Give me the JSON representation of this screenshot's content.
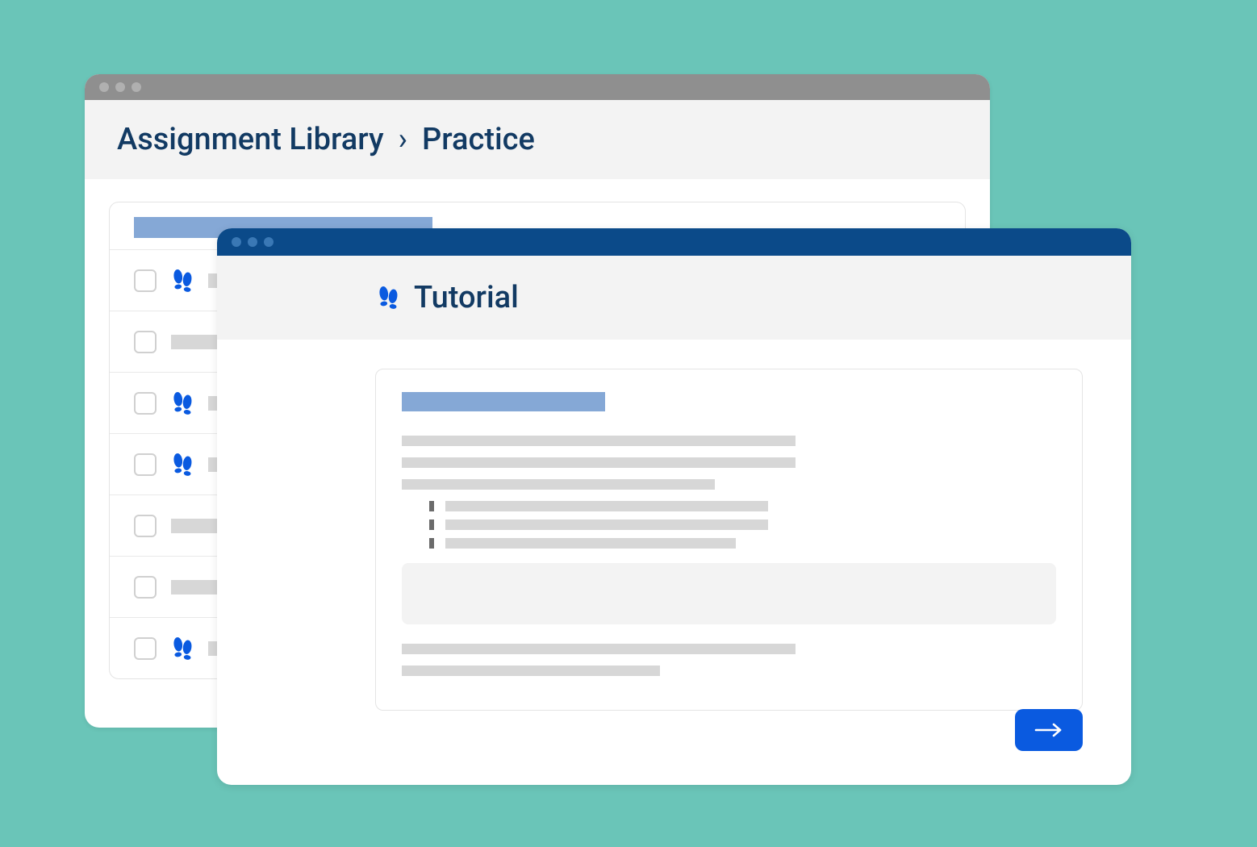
{
  "colors": {
    "background": "#6ac5b8",
    "back_titlebar": "#8f8f8f",
    "front_titlebar": "#0b4a89",
    "accent": "#0a5ae0",
    "heading_text": "#123a63",
    "placeholder_light_blue": "#85a8d6",
    "placeholder_gray": "#d7d7d7",
    "panel_gray": "#f3f3f3"
  },
  "back_window": {
    "breadcrumb": {
      "root": "Assignment Library",
      "separator": "›",
      "current": "Practice"
    },
    "list_items": [
      {
        "has_icon": true
      },
      {
        "has_icon": false
      },
      {
        "has_icon": true
      },
      {
        "has_icon": true
      },
      {
        "has_icon": false
      },
      {
        "has_icon": false
      },
      {
        "has_icon": true
      }
    ]
  },
  "front_window": {
    "title": "Tutorial"
  }
}
